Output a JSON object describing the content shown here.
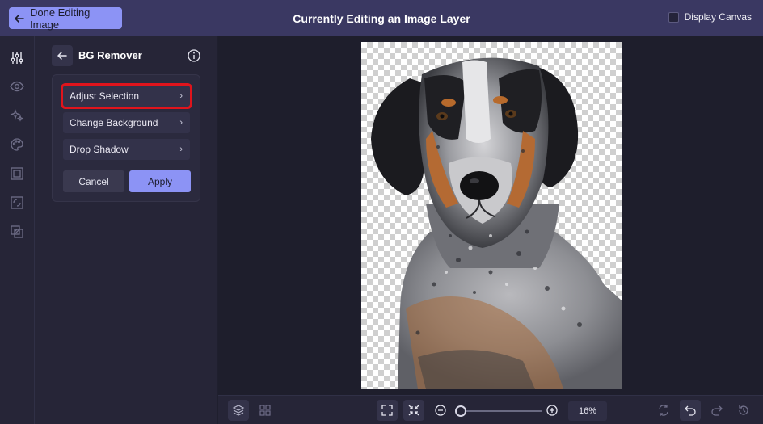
{
  "header": {
    "back_button_label": "Done Editing Image",
    "title": "Currently Editing an Image Layer",
    "display_canvas_label": "Display Canvas",
    "display_canvas_checked": false
  },
  "rail": {
    "icons": [
      "adjustments-icon",
      "eye-icon",
      "sparkle-icon",
      "palette-icon",
      "frame-icon",
      "crop-frame-icon",
      "overlay-icon"
    ]
  },
  "panel": {
    "title": "BG Remover",
    "menu": [
      {
        "label": "Adjust Selection",
        "selected": true
      },
      {
        "label": "Change Background",
        "selected": false
      },
      {
        "label": "Drop Shadow",
        "selected": false
      }
    ],
    "cancel_label": "Cancel",
    "apply_label": "Apply"
  },
  "bottombar": {
    "zoom": "16%",
    "zoom_level": 0.16
  },
  "colors": {
    "accent": "#8c93f5",
    "topbar": "#3a3862",
    "selection_outline": "#e0141c"
  }
}
